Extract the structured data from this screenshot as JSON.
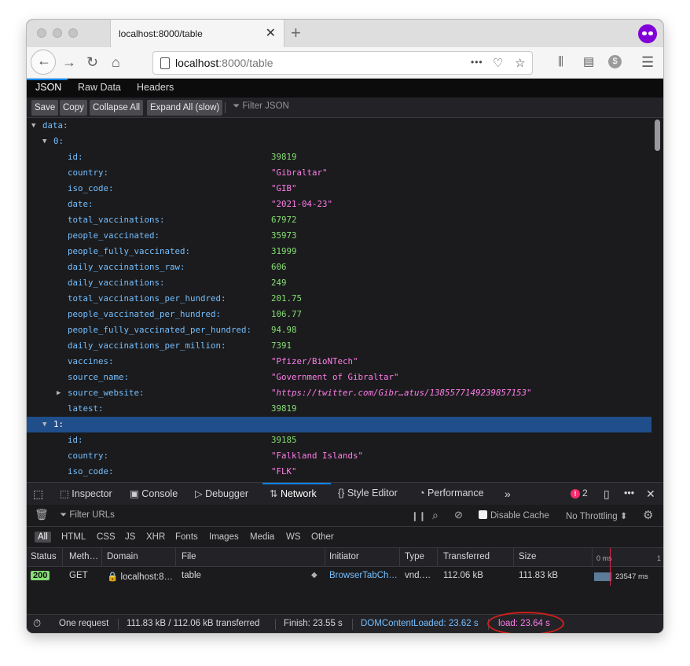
{
  "browser": {
    "tab_title": "localhost:8000/table",
    "tab_close": "✕",
    "new_tab": "+",
    "url_host": "localhost",
    "url_rest": ":8000/table",
    "url_more": "•••"
  },
  "json_viewer": {
    "tabs": [
      "JSON",
      "Raw Data",
      "Headers"
    ],
    "buttons": [
      "Save",
      "Copy",
      "Collapse All",
      "Expand All (slow)"
    ],
    "filter_placeholder": "Filter JSON",
    "rows": [
      {
        "key": "data:",
        "value": "",
        "type": "none",
        "twisty": "open"
      },
      {
        "key": "0:",
        "value": "",
        "type": "none",
        "twisty": "open"
      },
      {
        "key": "id:",
        "value": "39819",
        "type": "num"
      },
      {
        "key": "country:",
        "value": "\"Gibraltar\"",
        "type": "str"
      },
      {
        "key": "iso_code:",
        "value": "\"GIB\"",
        "type": "str"
      },
      {
        "key": "date:",
        "value": "\"2021-04-23\"",
        "type": "str"
      },
      {
        "key": "total_vaccinations:",
        "value": "67972",
        "type": "num"
      },
      {
        "key": "people_vaccinated:",
        "value": "35973",
        "type": "num"
      },
      {
        "key": "people_fully_vaccinated:",
        "value": "31999",
        "type": "num"
      },
      {
        "key": "daily_vaccinations_raw:",
        "value": "606",
        "type": "num"
      },
      {
        "key": "daily_vaccinations:",
        "value": "249",
        "type": "num"
      },
      {
        "key": "total_vaccinations_per_hundred:",
        "value": "201.75",
        "type": "num"
      },
      {
        "key": "people_vaccinated_per_hundred:",
        "value": "106.77",
        "type": "num"
      },
      {
        "key": "people_fully_vaccinated_per_hundred:",
        "value": "94.98",
        "type": "num"
      },
      {
        "key": "daily_vaccinations_per_million:",
        "value": "7391",
        "type": "num"
      },
      {
        "key": "vaccines:",
        "value": "\"Pfizer/BioNTech\"",
        "type": "str"
      },
      {
        "key": "source_name:",
        "value": "\"Government of Gibraltar\"",
        "type": "str"
      },
      {
        "key": "source_website:",
        "value": "\"https://twitter.com/Gibr…atus/1385577149239857153\"",
        "type": "url",
        "twisty": "closed"
      },
      {
        "key": "latest:",
        "value": "39819",
        "type": "num"
      },
      {
        "key": "1:",
        "value": "",
        "type": "none",
        "twisty": "open",
        "selected": true
      },
      {
        "key": "id:",
        "value": "39185",
        "type": "num"
      },
      {
        "key": "country:",
        "value": "\"Falkland Islands\"",
        "type": "str"
      },
      {
        "key": "iso_code:",
        "value": "\"FLK\"",
        "type": "str"
      }
    ]
  },
  "devtools": {
    "tools": [
      "Inspector",
      "Console",
      "Debugger",
      "Network",
      "Style Editor",
      "Performance"
    ],
    "error_count": "2",
    "filter_urls_placeholder": "Filter URLs",
    "pause_label": "❙❙",
    "disable_cache_label": "Disable Cache",
    "throttling_label": "No Throttling ⬍",
    "type_filters": [
      "All",
      "HTML",
      "CSS",
      "JS",
      "XHR",
      "Fonts",
      "Images",
      "Media",
      "WS",
      "Other"
    ],
    "columns": [
      "Status",
      "Meth…",
      "Domain",
      "File",
      "Initiator",
      "Type",
      "Transferred",
      "Size"
    ],
    "waterfall_ticks": [
      "0 ms",
      "1"
    ],
    "request": {
      "status": "200",
      "method": "GET",
      "domain": "localhost:8…",
      "file": "table",
      "initiator": "BrowserTabCh…",
      "type": "vnd.…",
      "transferred": "112.06 kB",
      "size": "111.83 kB",
      "waterfall_time": "23547 ms"
    },
    "status_bar": {
      "requests": "One request",
      "bytes": "111.83 kB / 112.06 kB transferred",
      "finish": "Finish: 23.55 s",
      "dom_content_loaded": "DOMContentLoaded: 23.62 s",
      "load": "load: 23.64 s"
    }
  },
  "colors": {
    "annotation_ellipse": "#d0201c",
    "number_value": "#86de74",
    "string_value": "#ff7de9",
    "key": "#75bfff"
  }
}
